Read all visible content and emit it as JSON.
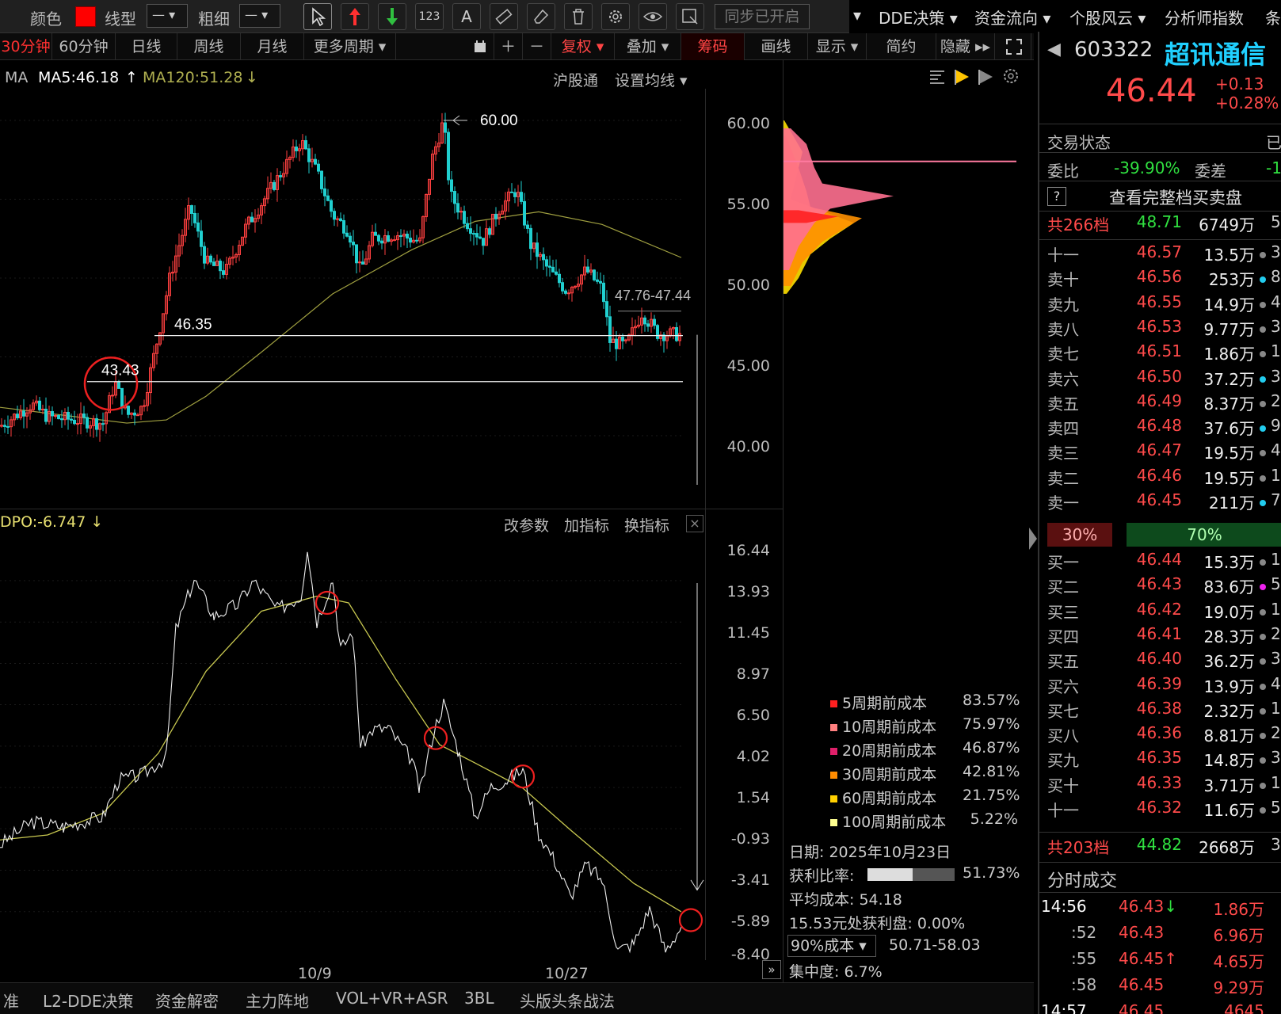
{
  "toolbar": {
    "color_label": "颜色",
    "color_value": "#ff0000",
    "line_type_label": "线型",
    "line_type_value": "—",
    "thickness_label": "粗细",
    "thickness_value": "—",
    "number_tool_label": "123",
    "text_tool_label": "A",
    "sync_label": "同步已开启"
  },
  "top_menu": [
    "DDE决策",
    "资金流向",
    "个股风云",
    "分析师指数",
    "条"
  ],
  "period_tabs": [
    "30分钟",
    "60分钟",
    "日线",
    "周线",
    "月线",
    "更多周期",
    "复权",
    "叠加",
    "筹码",
    "画线",
    "显示",
    "简约",
    "隐藏"
  ],
  "period_active": "30分钟",
  "ma": {
    "prefix": "MA",
    "ma5": "MA5:46.18",
    "ma120": "MA120:51.28",
    "hgt": "沪股通",
    "set_ma": "设置均线"
  },
  "price_chart": {
    "annotations": {
      "high": "60.00",
      "level1": "46.35",
      "level2": "43.43",
      "range": "47.76-47.44"
    },
    "y_ticks": [
      "60.00",
      "55.00",
      "50.00",
      "45.00",
      "40.00"
    ],
    "x_ticks": [
      "10/9",
      "10/27"
    ]
  },
  "indicator": {
    "name": "DPO:-6.747",
    "buttons": [
      "改参数",
      "加指标",
      "换指标"
    ],
    "close_label": "×",
    "y_ticks": [
      "16.44",
      "13.93",
      "11.45",
      "8.97",
      "6.50",
      "4.02",
      "1.54",
      "-0.93",
      "-3.41",
      "-5.89",
      "-8.40"
    ]
  },
  "chip_panel": {
    "legend": [
      {
        "label": "5周期前成本",
        "value": "83.57%",
        "color": "#ff2020"
      },
      {
        "label": "10周期前成本",
        "value": "75.97%",
        "color": "#ff8080"
      },
      {
        "label": "20周期前成本",
        "value": "46.87%",
        "color": "#e0206a"
      },
      {
        "label": "30周期前成本",
        "value": "42.81%",
        "color": "#ff8c00"
      },
      {
        "label": "60周期前成本",
        "value": "21.75%",
        "color": "#ffd000"
      },
      {
        "label": "100周期前成本",
        "value": "5.22%",
        "color": "#ffff90"
      }
    ],
    "date": "日期: 2025年10月23日",
    "profit_ratio_label": "获利比率:",
    "profit_ratio": "51.73%",
    "profit_ratio_fraction": 0.5173,
    "avg_cost": "平均成本: 54.18",
    "profit_at": "15.53元处获利盘: 0.00%",
    "cost_select": "90%成本",
    "cost_range": "50.71-58.03",
    "concentration": "集中度: 6.7%"
  },
  "bottom_tabs": [
    "准",
    "L2-DDE决策",
    "资金解密",
    "主力阵地",
    "VOL+VR+ASR",
    "3BL",
    "头版头条战法"
  ],
  "stock": {
    "code": "603322",
    "name": "超讯通信",
    "price": "46.44",
    "change": "+0.13",
    "change_pct": "+0.28%",
    "trade_status_label": "交易状态",
    "trade_status": "已",
    "weibi_label": "委比",
    "weibi": "-39.90%",
    "weicha_label": "委差",
    "weicha": "-1",
    "full_book": "查看完整档买卖盘",
    "help": "?"
  },
  "order_book": {
    "sell_total": {
      "label": "共266档",
      "price": "48.71",
      "vol": "6749万",
      "extra": "5."
    },
    "asks": [
      {
        "label": "十一",
        "price": "46.57",
        "vol": "13.5万",
        "dot": "#888",
        "extra": "3"
      },
      {
        "label": "卖十",
        "price": "46.56",
        "vol": "253万",
        "dot": "#22ccee",
        "extra": "8"
      },
      {
        "label": "卖九",
        "price": "46.55",
        "vol": "14.9万",
        "dot": "#888",
        "extra": "4"
      },
      {
        "label": "卖八",
        "price": "46.53",
        "vol": "9.77万",
        "dot": "#888",
        "extra": "3"
      },
      {
        "label": "卖七",
        "price": "46.51",
        "vol": "1.86万",
        "dot": "#888",
        "extra": "1"
      },
      {
        "label": "卖六",
        "price": "46.50",
        "vol": "37.2万",
        "dot": "#22ccee",
        "extra": "3"
      },
      {
        "label": "卖五",
        "price": "46.49",
        "vol": "8.37万",
        "dot": "#888",
        "extra": "2"
      },
      {
        "label": "卖四",
        "price": "46.48",
        "vol": "37.6万",
        "dot": "#22ccee",
        "extra": "9"
      },
      {
        "label": "卖三",
        "price": "46.47",
        "vol": "19.5万",
        "dot": "#888",
        "extra": "4"
      },
      {
        "label": "卖二",
        "price": "46.46",
        "vol": "19.5万",
        "dot": "#888",
        "extra": "1"
      },
      {
        "label": "卖一",
        "price": "46.45",
        "vol": "211万",
        "dot": "#22ccee",
        "extra": "7"
      }
    ],
    "ratio_buy": "30%",
    "ratio_sell": "70%",
    "ratio_buy_fraction": 0.3,
    "bids": [
      {
        "label": "买一",
        "price": "46.44",
        "vol": "15.3万",
        "dot": "#888",
        "extra": "1"
      },
      {
        "label": "买二",
        "price": "46.43",
        "vol": "83.6万",
        "dot": "#ee22ee",
        "extra": "5"
      },
      {
        "label": "买三",
        "price": "46.42",
        "vol": "19.0万",
        "dot": "#888",
        "extra": "1"
      },
      {
        "label": "买四",
        "price": "46.41",
        "vol": "28.3万",
        "dot": "#888",
        "extra": "2"
      },
      {
        "label": "买五",
        "price": "46.40",
        "vol": "36.2万",
        "dot": "#888",
        "extra": "3"
      },
      {
        "label": "买六",
        "price": "46.39",
        "vol": "13.9万",
        "dot": "#888",
        "extra": "4"
      },
      {
        "label": "买七",
        "price": "46.38",
        "vol": "2.32万",
        "dot": "#888",
        "extra": "1"
      },
      {
        "label": "买八",
        "price": "46.36",
        "vol": "8.81万",
        "dot": "#888",
        "extra": "2"
      },
      {
        "label": "买九",
        "price": "46.35",
        "vol": "14.8万",
        "dot": "#888",
        "extra": "3"
      },
      {
        "label": "买十",
        "price": "46.33",
        "vol": "3.71万",
        "dot": "#888",
        "extra": "1"
      },
      {
        "label": "十一",
        "price": "46.32",
        "vol": "11.6万",
        "dot": "#888",
        "extra": "5"
      }
    ],
    "buy_total": {
      "label": "共203档",
      "price": "44.82",
      "vol": "2668万",
      "extra": "3."
    }
  },
  "tick_trades": {
    "title": "分时成交",
    "rows": [
      {
        "time": "14:56",
        "price": "46.43",
        "arrow": "down",
        "vol": "1.86万"
      },
      {
        "time": ":52",
        "price": "46.43",
        "arrow": "",
        "vol": "6.96万"
      },
      {
        "time": ":55",
        "price": "46.45",
        "arrow": "up",
        "vol": "4.65万"
      },
      {
        "time": ":58",
        "price": "46.45",
        "arrow": "",
        "vol": "9.29万"
      },
      {
        "time": "14:57",
        "price": "46.45",
        "arrow": "",
        "vol": "4645"
      }
    ]
  }
}
